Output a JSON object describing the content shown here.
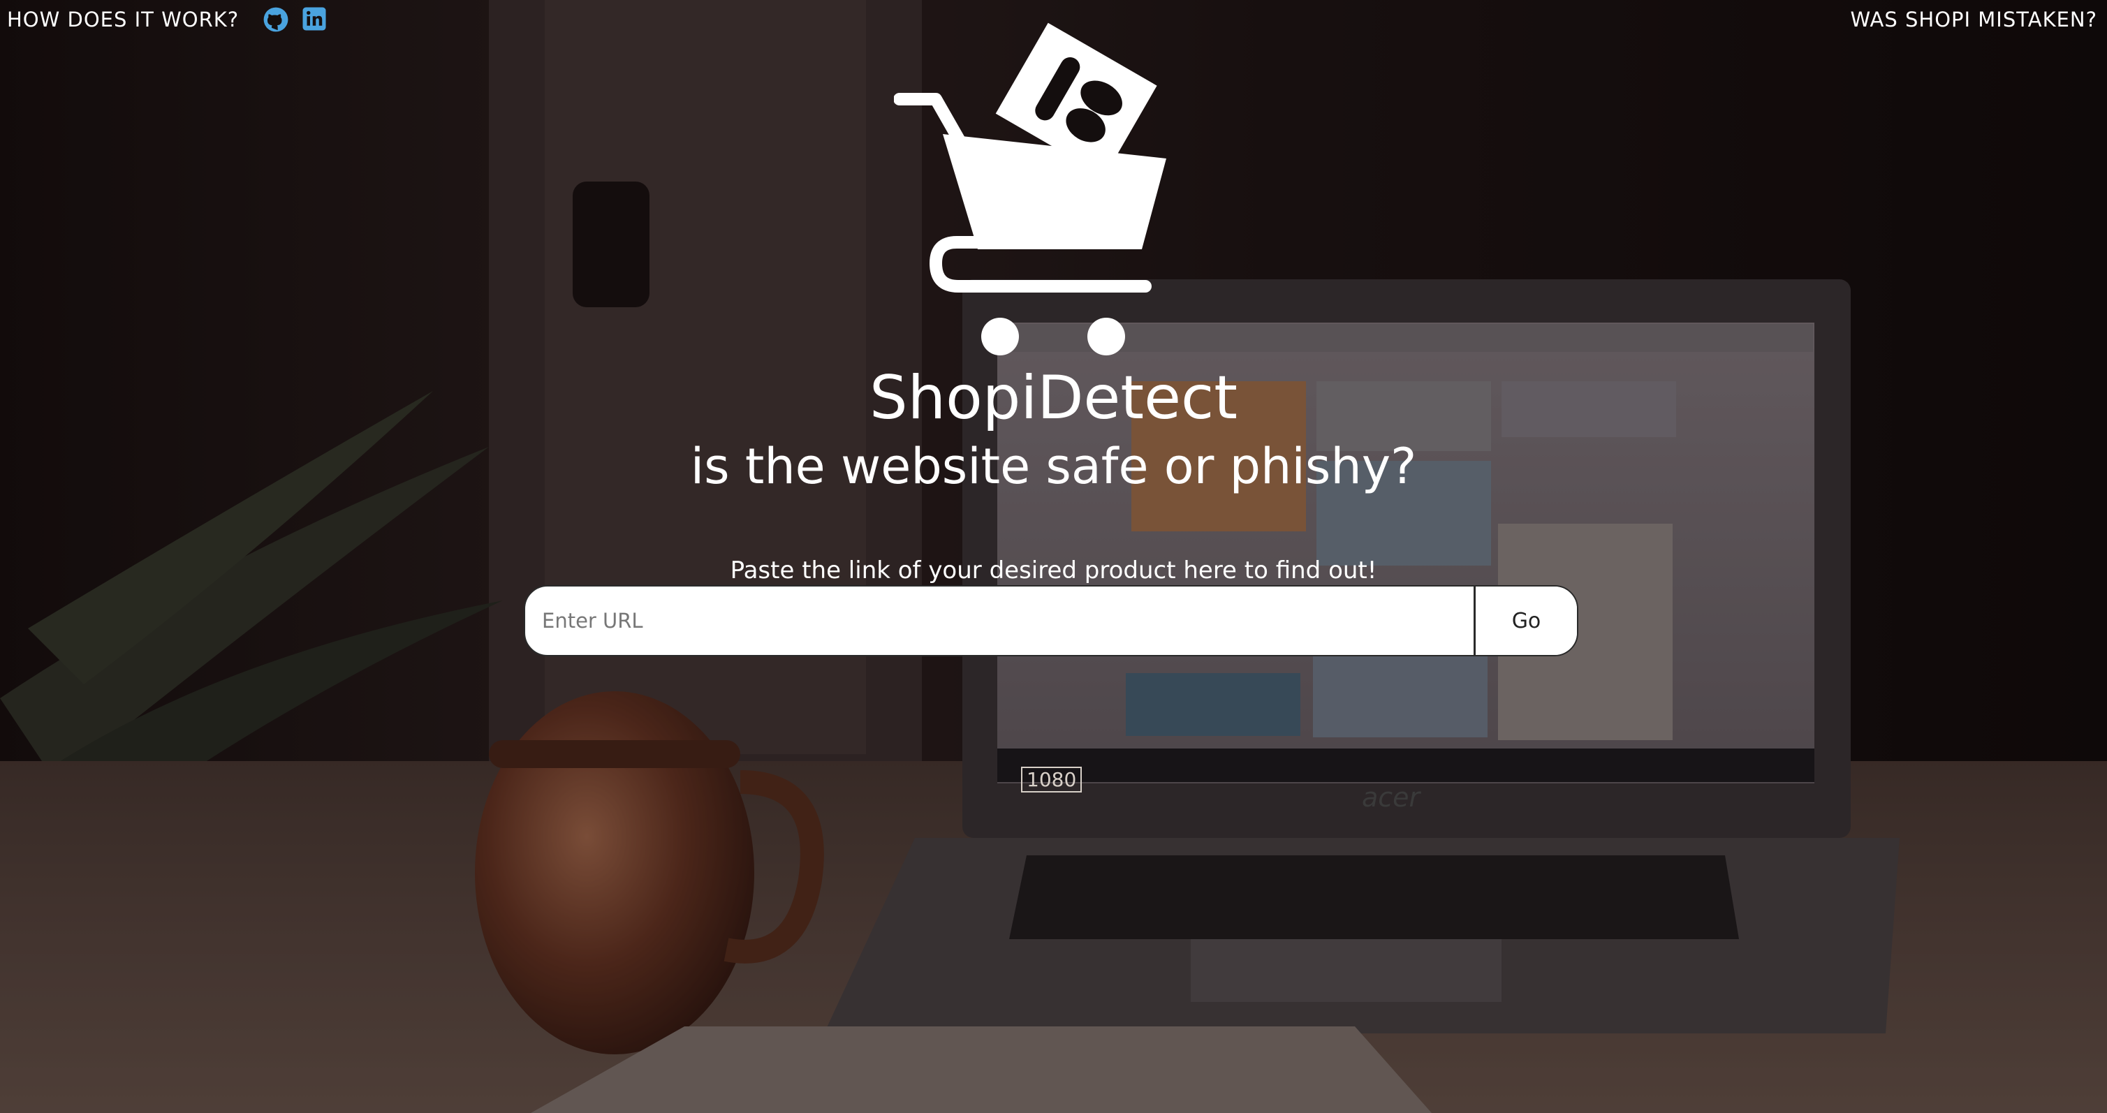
{
  "nav": {
    "how_it_works": "HOW DOES IT WORK?",
    "was_mistaken": "WAS SHOPI MISTAKEN?"
  },
  "icons": {
    "github": "github-icon",
    "linkedin": "linkedin-icon",
    "accent": "#4aa3df"
  },
  "hero": {
    "title": "ShopiDetect",
    "subtitle": "is the website safe or phishy?",
    "hint": "Paste the link of your desired product here to find out!"
  },
  "search": {
    "placeholder": "Enter URL",
    "value": "",
    "button_label": "Go"
  },
  "screen_text": {
    "brand": "acer",
    "badge": "1080"
  }
}
